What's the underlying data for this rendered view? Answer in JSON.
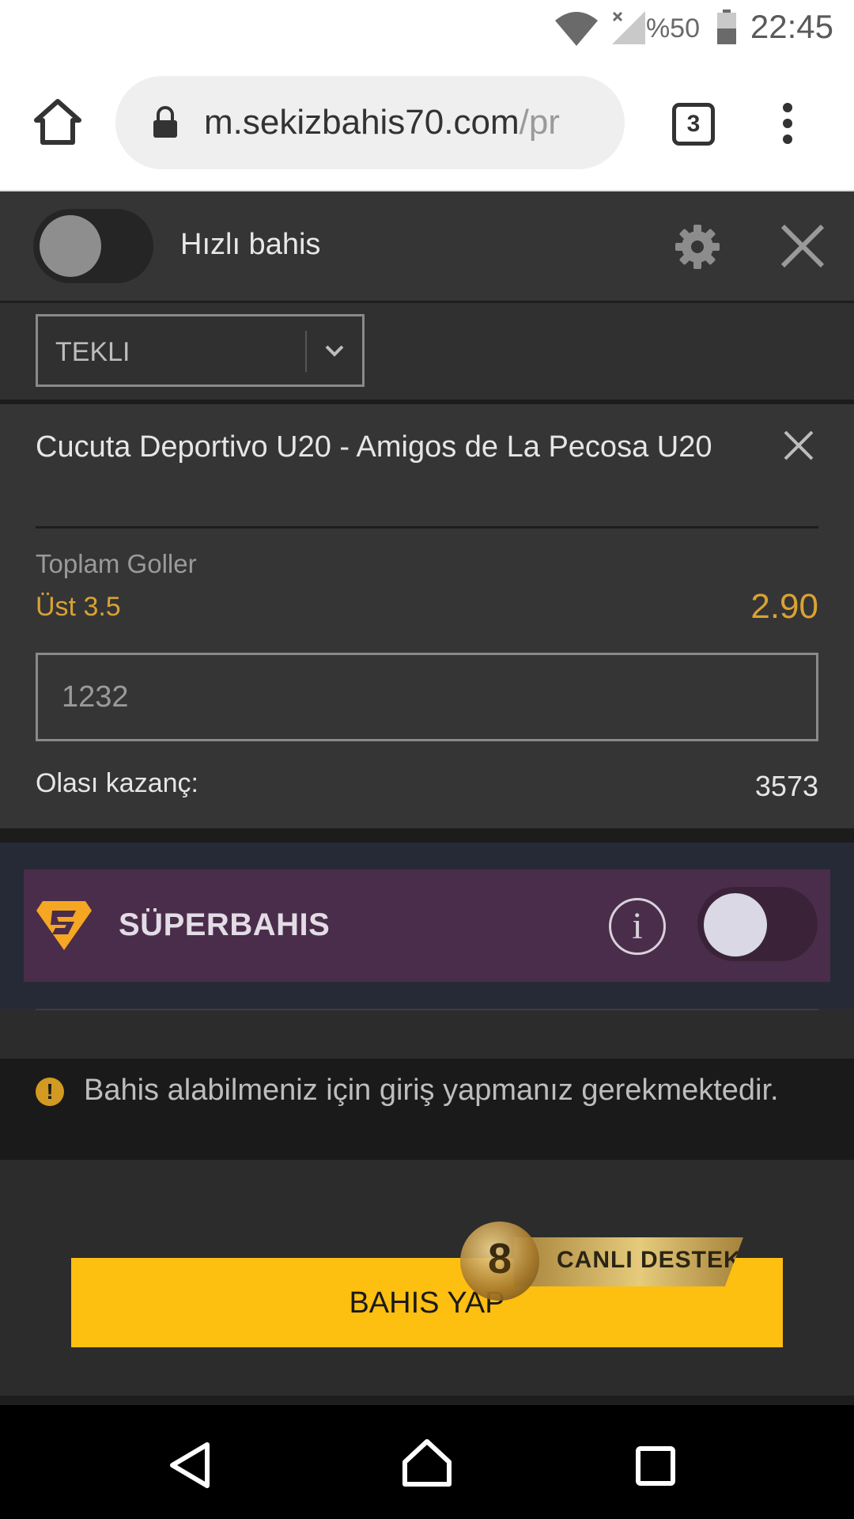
{
  "status_bar": {
    "battery": "%50",
    "time": "22:45"
  },
  "browser": {
    "url_main": "m.sekizbahis70.com",
    "url_rest": "/pr",
    "tab_count": "3"
  },
  "header": {
    "quick_bet_label": "Hızlı bahis",
    "quick_bet_on": false
  },
  "bet_type": {
    "selected": "TEKLI"
  },
  "bet": {
    "match": "Cucuta Deportivo U20 - Amigos de La Pecosa U20",
    "market": "Toplam Goller",
    "outcome": "Üst 3.5",
    "odds": "2.90",
    "stake": "1232",
    "potential_label": "Olası kazanç:",
    "potential_value": "3573"
  },
  "super_bet": {
    "title": "SÜPERBAHIS",
    "info": "i",
    "enabled": false
  },
  "warning": {
    "text": "Bahis alabilmeniz için giriş yapmanız gerekmektedir."
  },
  "place_bet": {
    "label": "BAHIS YAP"
  },
  "live_support": {
    "label": "CANLI DESTEK"
  },
  "colors": {
    "accent": "#fdbf10",
    "odds": "#d9a235",
    "super_bg": "#4a2d4a"
  }
}
